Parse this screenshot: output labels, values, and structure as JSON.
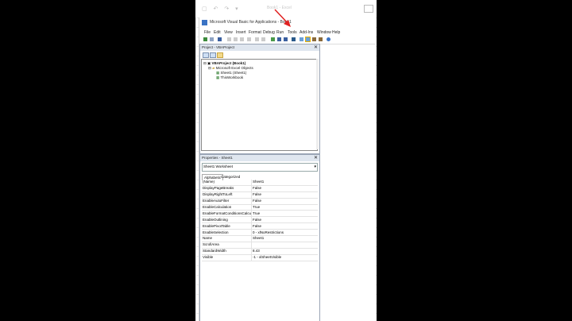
{
  "excel": {
    "title_hint": "Book1 - Excel",
    "quick_access": "▢ ↶ ↷ ▾"
  },
  "vbe": {
    "title": "Microsoft Visual Basic for Applications - Book1",
    "menu": [
      "File",
      "Edit",
      "View",
      "Insert",
      "Format",
      "Debug",
      "Run",
      "Tools",
      "Add-Ins",
      "Window",
      "Help"
    ]
  },
  "project": {
    "title": "Project - VBAProject",
    "tree": [
      {
        "label": "VBAProject (Book1)",
        "level": 0,
        "bold": true
      },
      {
        "label": "Microsoft Excel Objects",
        "level": 1,
        "bold": false
      },
      {
        "label": "Sheet1 (Sheet1)",
        "level": 2,
        "bold": false
      },
      {
        "label": "ThisWorkbook",
        "level": 2,
        "bold": false
      }
    ]
  },
  "properties": {
    "title": "Properties - Sheet1",
    "object": "Sheet1 Worksheet",
    "tabs": [
      "Alphabetic",
      "Categorized"
    ],
    "rows": [
      [
        "(Name)",
        "Sheet1"
      ],
      [
        "DisplayPageBreaks",
        "False"
      ],
      [
        "DisplayRightToLeft",
        "False"
      ],
      [
        "EnableAutoFilter",
        "False"
      ],
      [
        "EnableCalculation",
        "True"
      ],
      [
        "EnableFormatConditionsCalculation",
        "True"
      ],
      [
        "EnableOutlining",
        "False"
      ],
      [
        "EnablePivotTable",
        "False"
      ],
      [
        "EnableSelection",
        "0 - xlNoRestrictions"
      ],
      [
        "Name",
        "Sheet1"
      ],
      [
        "ScrollArea",
        ""
      ],
      [
        "StandardWidth",
        "8.43"
      ],
      [
        "Visible",
        "-1 - xlSheetVisible"
      ]
    ]
  },
  "annotation": {
    "arrow_color": "#e02020"
  }
}
